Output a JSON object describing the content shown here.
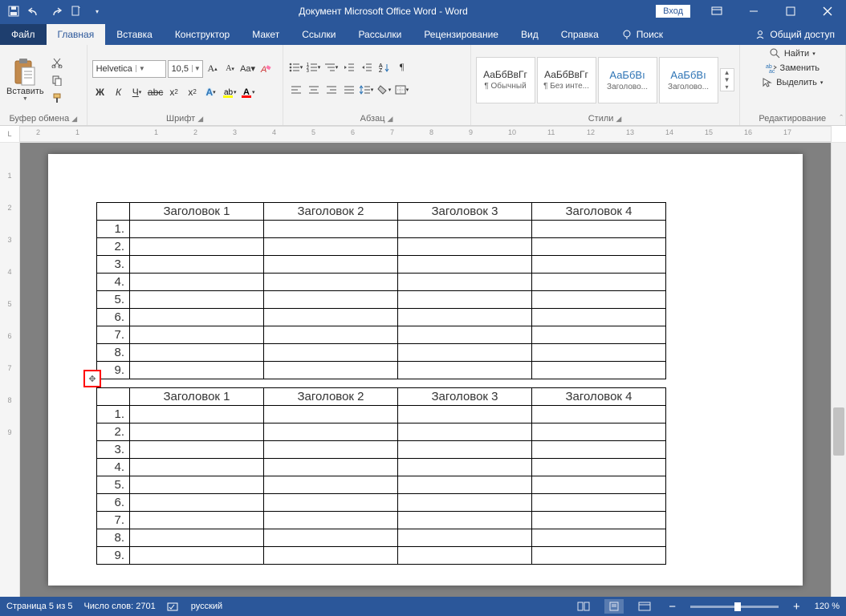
{
  "title": "Документ Microsoft Office Word  -  Word",
  "login": "Вход",
  "tabs": [
    "Файл",
    "Главная",
    "Вставка",
    "Конструктор",
    "Макет",
    "Ссылки",
    "Рассылки",
    "Рецензирование",
    "Вид",
    "Справка"
  ],
  "search": "Поиск",
  "share": "Общий доступ",
  "ribbon": {
    "clipboard": {
      "paste": "Вставить",
      "label": "Буфер обмена"
    },
    "font": {
      "name": "Helvetica",
      "size": "10,5",
      "label": "Шрифт",
      "bold": "Ж",
      "italic": "К",
      "underline": "Ч"
    },
    "paragraph": {
      "label": "Абзац"
    },
    "styles": {
      "label": "Стили",
      "preview": "АаБбВвГг",
      "previewH": "АаБбВı",
      "items": [
        "¶ Обычный",
        "¶ Без инте...",
        "Заголово...",
        "Заголово..."
      ]
    },
    "editing": {
      "label": "Редактирование",
      "find": "Найти",
      "replace": "Заменить",
      "select": "Выделить"
    }
  },
  "tables": {
    "headers": [
      "Заголовок 1",
      "Заголовок 2",
      "Заголовок 3",
      "Заголовок 4"
    ],
    "rows": [
      "1.",
      "2.",
      "3.",
      "4.",
      "5.",
      "6.",
      "7.",
      "8.",
      "9."
    ]
  },
  "status": {
    "page": "Страница 5 из 5",
    "words": "Число слов: 2701",
    "lang": "русский",
    "zoom": "120 %"
  },
  "ruler_h": [
    "2",
    "1",
    "",
    "1",
    "2",
    "3",
    "4",
    "5",
    "6",
    "7",
    "8",
    "9",
    "10",
    "11",
    "12",
    "13",
    "14",
    "15",
    "16",
    "17"
  ],
  "ruler_v": [
    "",
    "1",
    "2",
    "3",
    "4",
    "5",
    "6",
    "7",
    "8",
    "9"
  ]
}
